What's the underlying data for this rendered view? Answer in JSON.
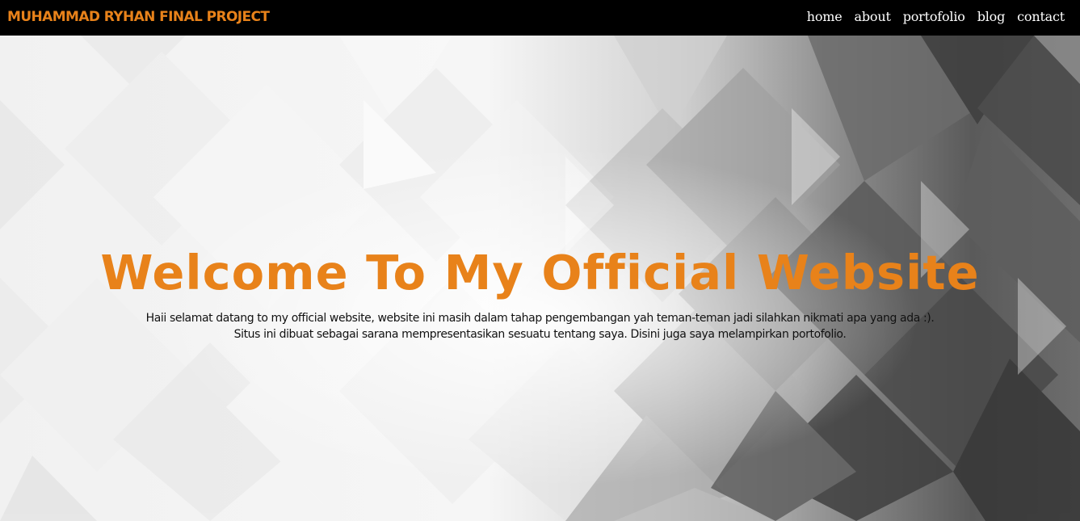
{
  "navbar": {
    "brand": "MUHAMMAD RYHAN FINAL PROJECT",
    "links": [
      {
        "label": "home"
      },
      {
        "label": "about"
      },
      {
        "label": "portofolio"
      },
      {
        "label": "blog"
      },
      {
        "label": "contact"
      }
    ]
  },
  "hero": {
    "title": "Welcome To My Official Website",
    "line1": "Haii selamat datang to my official website, website ini masih dalam tahap pengembangan yah teman-teman jadi silahkan nikmati apa yang ada :).",
    "line2": "Situs ini dibuat sebagai sarana mempresentasikan sesuatu tentang saya. Disini juga saya melampirkan portofolio."
  },
  "colors": {
    "accent": "#e8821a",
    "navbar_bg": "#000000",
    "nav_text": "#ffffff"
  }
}
